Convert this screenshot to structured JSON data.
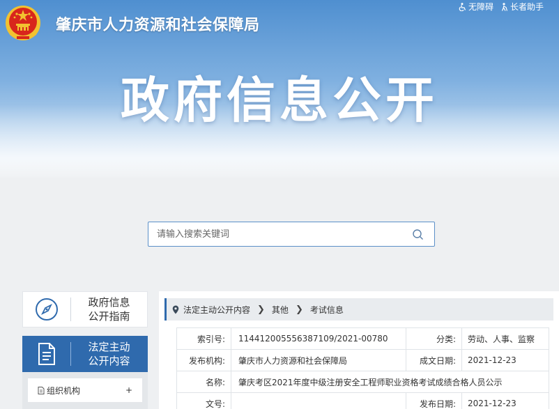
{
  "header": {
    "site_title": "肇庆市人力资源和社会保障局",
    "banner_heading": "政府信息公开",
    "accessibility_link": "无障碍",
    "elderly_link": "长者助手"
  },
  "search": {
    "placeholder": "请输入搜索关键词"
  },
  "sidebar": {
    "items": [
      {
        "line1": "政府信息",
        "line2": "公开指南",
        "icon": "compass-icon",
        "active": false
      },
      {
        "line1": "法定主动",
        "line2": "公开内容",
        "icon": "document-icon",
        "active": true
      }
    ],
    "sub_items": [
      {
        "label": "组织机构",
        "expand": "+"
      }
    ]
  },
  "breadcrumb": [
    "法定主动公开内容",
    "其他",
    "考试信息"
  ],
  "meta": {
    "index_no_label": "索引号:",
    "index_no": "114412005556387109/2021-00780",
    "category_label": "分类:",
    "category": "劳动、人事、监察",
    "publisher_label": "发布机构:",
    "publisher": "肇庆市人力资源和社会保障局",
    "created_label": "成文日期:",
    "created": "2021-12-23",
    "name_label": "名称:",
    "name": "肇庆考区2021年度中级注册安全工程师职业资格考试成绩合格人员公示",
    "doc_no_label": "文号:",
    "doc_no": "",
    "published_label": "发布日期:",
    "published": "2021-12-23"
  },
  "colors": {
    "accent": "#2f6aad",
    "banner_top": "#4f8fd0",
    "emblem_red": "#d8261c",
    "emblem_gold": "#f2c230"
  }
}
